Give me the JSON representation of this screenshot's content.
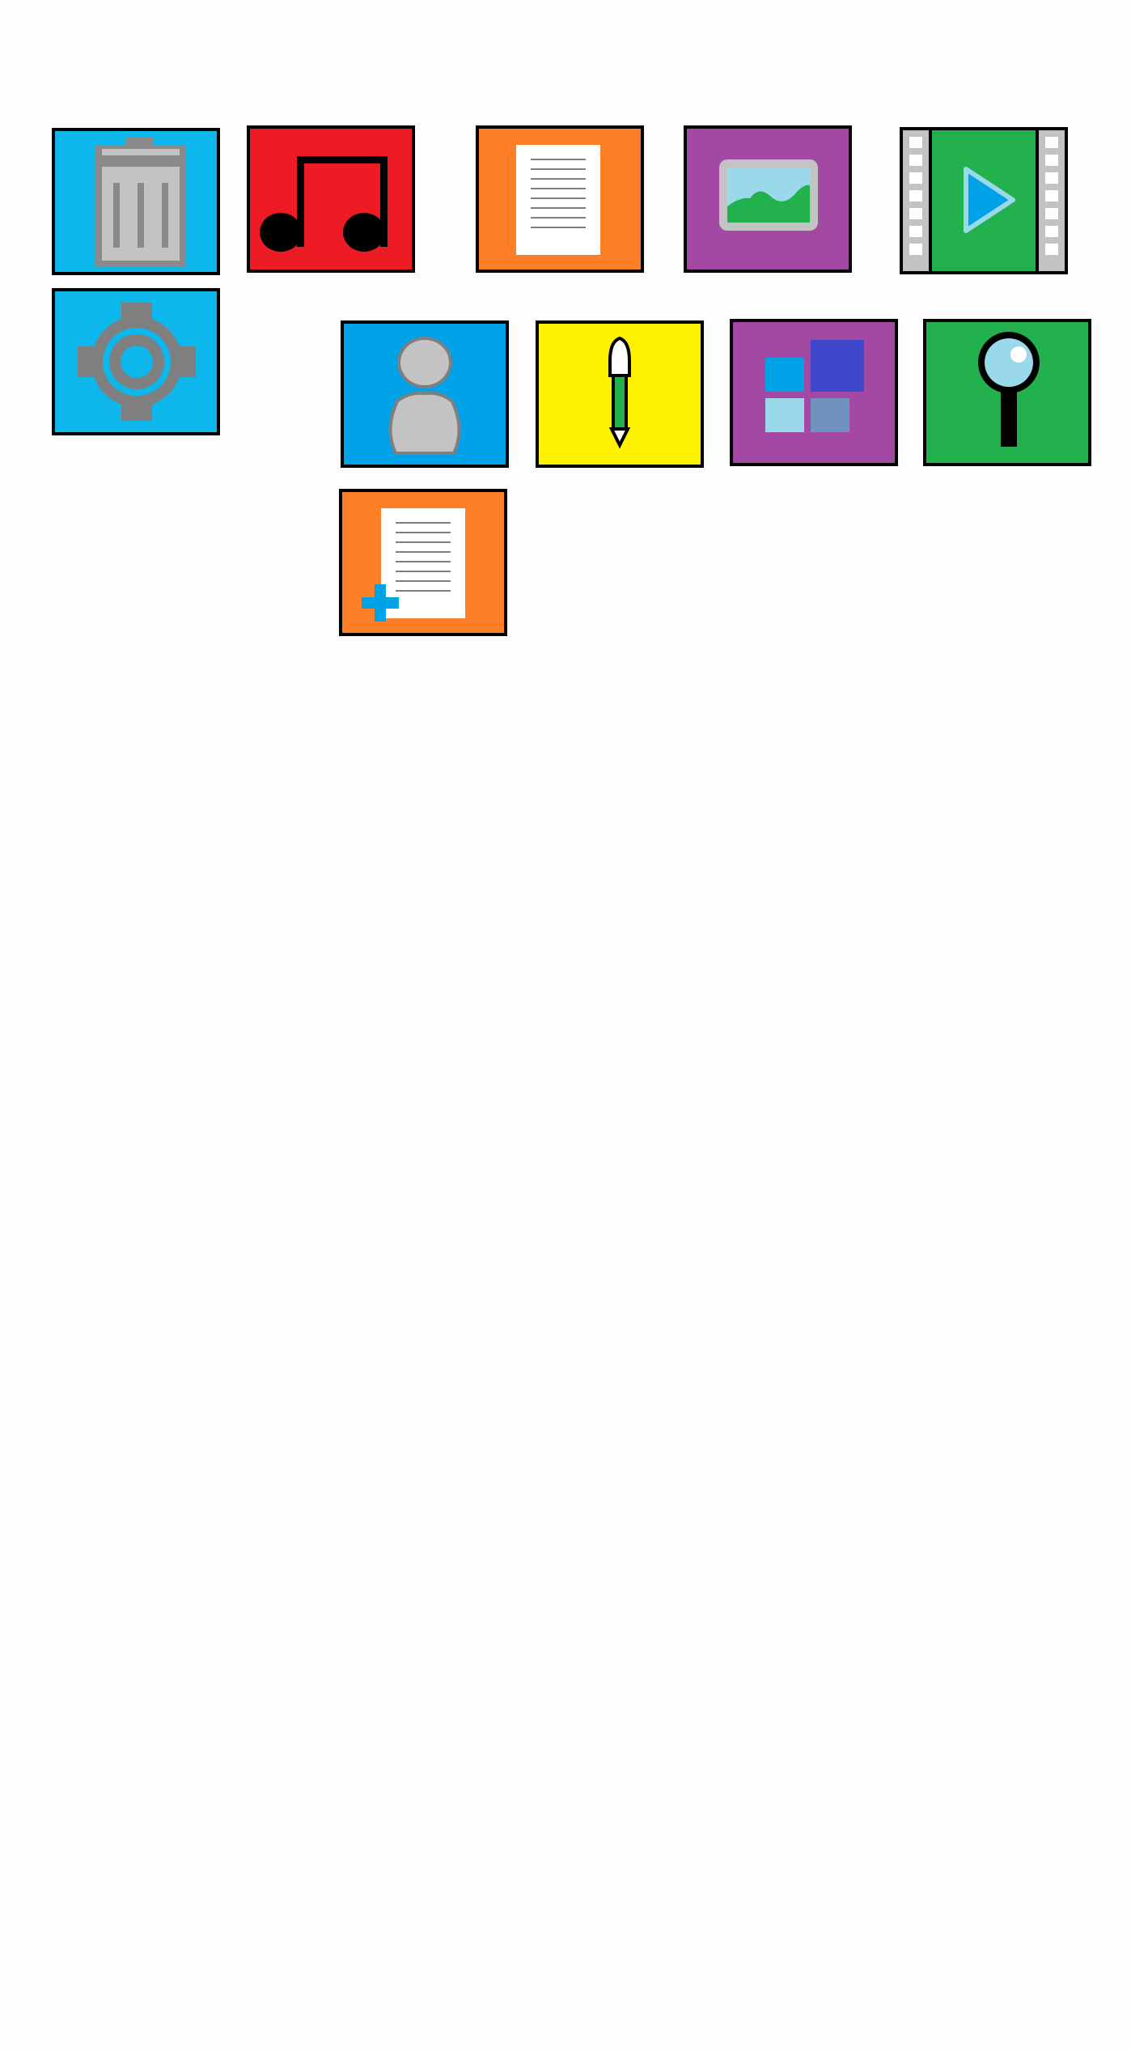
{
  "tiles": [
    {
      "id": "recycle-bin",
      "icon": "trash-icon",
      "color": "#0DB7EC"
    },
    {
      "id": "music",
      "icon": "music-note-icon",
      "color": "#ED1C24"
    },
    {
      "id": "document",
      "icon": "document-icon",
      "color": "#FF7F27"
    },
    {
      "id": "pictures",
      "icon": "picture-icon",
      "color": "#A349A4"
    },
    {
      "id": "video",
      "icon": "play-icon",
      "color": "#22B14C"
    },
    {
      "id": "settings",
      "icon": "gear-icon",
      "color": "#0DB7EC"
    },
    {
      "id": "user",
      "icon": "user-icon",
      "color": "#00A2E8"
    },
    {
      "id": "pen",
      "icon": "pen-icon",
      "color": "#FFF200"
    },
    {
      "id": "apps",
      "icon": "app-grid-icon",
      "color": "#A349A4"
    },
    {
      "id": "search",
      "icon": "magnifier-icon",
      "color": "#22B14C"
    },
    {
      "id": "new-document",
      "icon": "new-document-icon",
      "color": "#FF7F27"
    }
  ]
}
